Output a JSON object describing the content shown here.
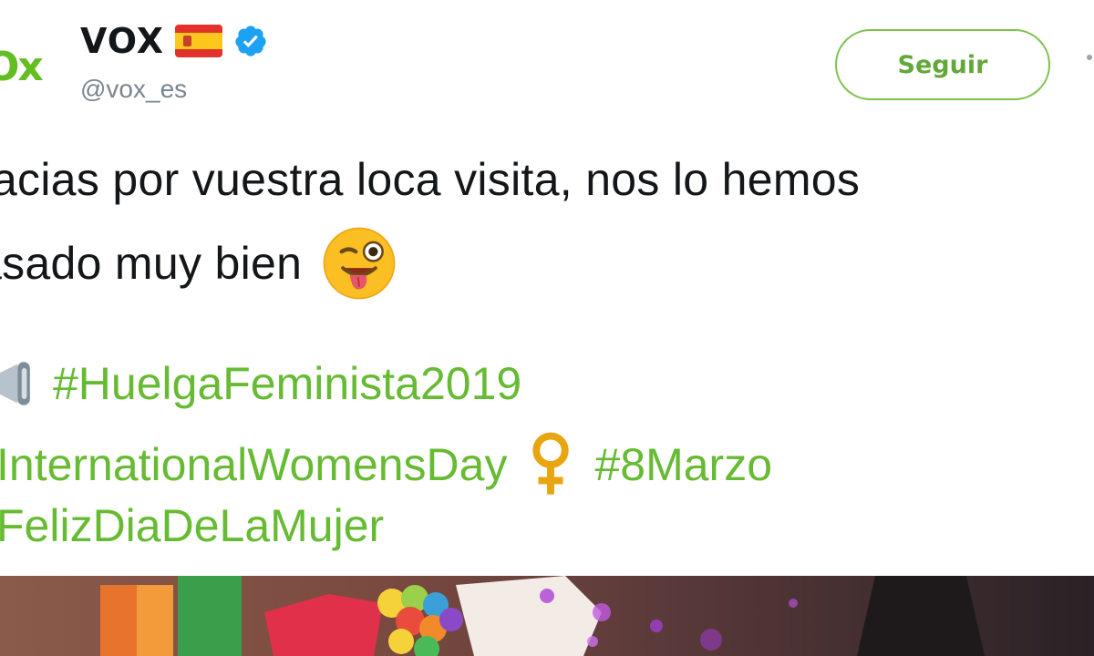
{
  "account": {
    "logo_text": "Ox",
    "display_name": "VOX",
    "handle": "@vox_es",
    "verified": true,
    "flag": "spain-flag-icon"
  },
  "actions": {
    "follow_label": "Seguir"
  },
  "tweet": {
    "line1": "racias por vuestra loca visita, nos lo hemos",
    "line2": "asado muy bien",
    "hashtag1": "#HuelgaFeminista2019",
    "hashtag2": "InternationalWomensDay",
    "hashtag3": "#8Marzo",
    "hashtag4": "FelizDiaDeLaMujer"
  },
  "colors": {
    "brand_green": "#63be21",
    "hashtag_green": "#66bb33",
    "verified_blue": "#1da1f2"
  }
}
